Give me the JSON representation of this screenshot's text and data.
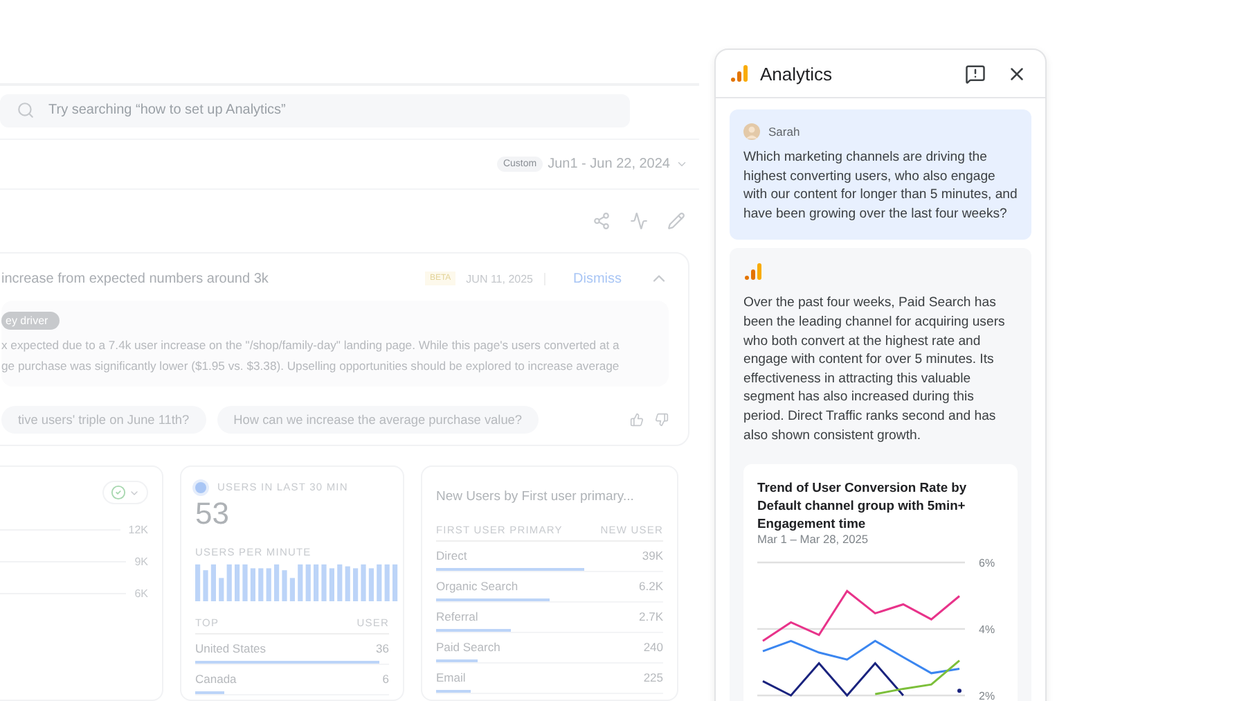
{
  "search": {
    "placeholder": "Try searching “how to set up Analytics”"
  },
  "date_range": {
    "badge": "Custom",
    "label": "Jun1 - Jun 22, 2024"
  },
  "insight": {
    "title": "increase from expected numbers around 3k",
    "badge": "BETA",
    "date": "JUN 11, 2025",
    "dismiss": "Dismiss",
    "expanded": true,
    "tag": "ey driver",
    "lines": [
      "x expected due to a 7.4k user increase on the \"/shop/family-day\" landing page. While this page's users converted at a",
      "ge purchase was significantly lower ($1.95 vs. $3.38).  Upselling opportunities should be explored to increase average"
    ],
    "suggestions": [
      "tive users' triple on June 11th?",
      "How can we increase the average purchase value?"
    ]
  },
  "trend_card": {
    "axis_labels": [
      "12K",
      "9K",
      "6K"
    ]
  },
  "realtime_card": {
    "title": "USERS IN LAST 30 MIN",
    "value": "53",
    "subtitle": "USERS PER MINUTE",
    "columns": [
      "TOP",
      "USER"
    ],
    "rows": [
      {
        "name": "United States",
        "value": "36",
        "level": 0.95
      },
      {
        "name": "Canada",
        "value": "6",
        "level": 0.15
      }
    ]
  },
  "channels_card": {
    "title": "New Users by First user primary...",
    "columns": [
      "FIRST USER PRIMARY",
      "NEW USER"
    ],
    "rows": [
      {
        "name": "Direct",
        "value": "39K",
        "level": 0.65
      },
      {
        "name": "Organic Search",
        "value": "6.2K",
        "level": 0.5
      },
      {
        "name": "Referral",
        "value": "2.7K",
        "level": 0.33
      },
      {
        "name": "Paid Search",
        "value": "240",
        "level": 0.18
      },
      {
        "name": "Email",
        "value": "225",
        "level": 0.15
      }
    ]
  },
  "panel": {
    "title": "Analytics",
    "messages": [
      {
        "kind": "user",
        "author": "Sarah",
        "text": "Which marketing channels are driving the highest converting users, who also engage with our content for longer than 5 minutes, and have been growing over the last four weeks?"
      },
      {
        "kind": "assistant",
        "text": "Over the past four weeks, Paid Search has been the leading channel for acquiring users who both convert at the highest rate and engage with content for over 5 minutes. Its effectiveness in attracting this valuable segment has also increased during this period. Direct Traffic ranks second and has also shown consistent growth.",
        "chart": {
          "title": "Trend of User Conversion Rate by Default channel group with 5min+ Engagement time",
          "subtitle": "Mar 1 – Mar 28, 2025",
          "chart_data": {
            "type": "line",
            "ylim": [
              2,
              6
            ],
            "yticks": [
              {
                "value": 6,
                "label": "6%"
              },
              {
                "value": 4,
                "label": "4%"
              },
              {
                "value": 2,
                "label": "2%"
              }
            ],
            "series": [
              {
                "color": "#e8338a",
                "values": [
                  3.64,
                  4.2,
                  3.82,
                  5.14,
                  4.47,
                  4.74,
                  4.29,
                  4.99
                ]
              },
              {
                "color": "#3b86f0",
                "values": [
                  3.33,
                  3.64,
                  3.29,
                  3.08,
                  3.64,
                  3.15,
                  2.67,
                  2.8
                ]
              },
              {
                "color": "#1a237e",
                "values": [
                  2.43,
                  2.0,
                  2.97,
                  2.0,
                  2.97,
                  2.0,
                  null,
                  2.14
                ]
              },
              {
                "color": "#7cbf3a",
                "values": [
                  null,
                  null,
                  null,
                  null,
                  2.04,
                  2.2,
                  2.33,
                  3.05
                ]
              }
            ]
          }
        }
      }
    ]
  }
}
